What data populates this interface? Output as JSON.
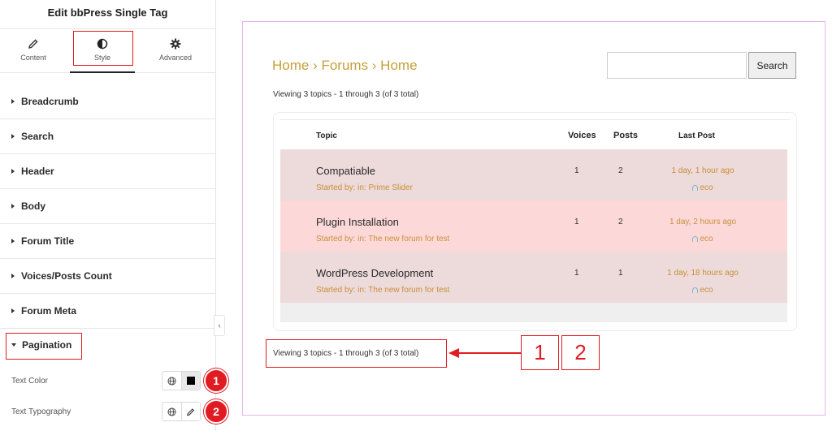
{
  "panel": {
    "title": "Edit bbPress Single Tag",
    "tabs": [
      {
        "label": "Content",
        "icon": "pencil-icon"
      },
      {
        "label": "Style",
        "icon": "half-circle-icon"
      },
      {
        "label": "Advanced",
        "icon": "gear-icon"
      }
    ],
    "active_tab": "Style",
    "sections": [
      {
        "label": "Breadcrumb"
      },
      {
        "label": "Search"
      },
      {
        "label": "Header"
      },
      {
        "label": "Body"
      },
      {
        "label": "Forum Title"
      },
      {
        "label": "Voices/Posts Count"
      },
      {
        "label": "Forum Meta"
      }
    ],
    "open_section": {
      "label": "Pagination"
    },
    "controls": [
      {
        "label": "Text Color",
        "badge": "1",
        "icon": "color-swatch-icon",
        "swatch_color": "#000000"
      },
      {
        "label": "Text Typography",
        "badge": "2",
        "icon": "pencil-edit-icon"
      }
    ]
  },
  "preview": {
    "breadcrumb": "Home › Forums › Home",
    "search": {
      "placeholder": "",
      "button_label": "Search"
    },
    "viewing_top": "Viewing 3 topics - 1 through 3 (of 3 total)",
    "table": {
      "headers": {
        "topic": "Topic",
        "voices": "Voices",
        "posts": "Posts",
        "last_post": "Last Post"
      },
      "rows": [
        {
          "title": "Compatiable",
          "meta": "Started by: in: Prime Slider",
          "voices": "1",
          "posts": "2",
          "last_post": "1 day, 1 hour ago",
          "author": "eco"
        },
        {
          "title": "Plugin Installation",
          "meta": "Started by: in: The new forum for test",
          "voices": "1",
          "posts": "2",
          "last_post": "1 day, 2 hours ago",
          "author": "eco"
        },
        {
          "title": "WordPress Development",
          "meta": "Started by: in: The new forum for test",
          "voices": "1",
          "posts": "1",
          "last_post": "1 day, 18 hours ago",
          "author": "eco"
        }
      ]
    },
    "viewing_bottom": "Viewing 3 topics - 1 through 3 (of 3 total)",
    "callouts": [
      "1",
      "2"
    ]
  },
  "colors": {
    "accent_red": "#e11b22",
    "link_gold": "#c4a03a",
    "row_a": "#eddada",
    "row_b": "#fcd9d8",
    "canvas_border": "#e6b3ec"
  }
}
